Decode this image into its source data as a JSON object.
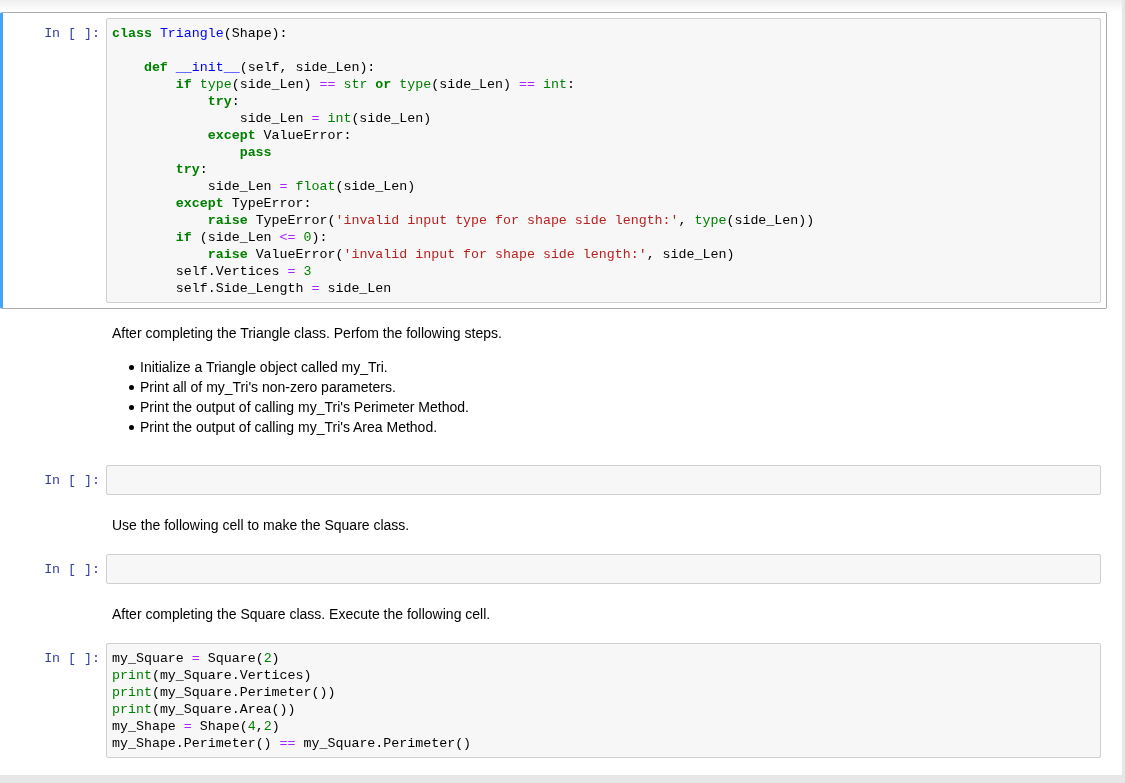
{
  "notebook": {
    "cells": [
      {
        "kind": "code",
        "selected": true,
        "prompt": "In [ ]:",
        "lines": [
          {
            "kind": "code",
            "tokens": [
              {
                "kind": "keyword",
                "text": "class"
              },
              {
                "kind": "name",
                "text": " Triangle"
              },
              {
                "kind": "plain",
                "text": "(Shape):"
              }
            ]
          },
          {
            "kind": "blank"
          },
          {
            "kind": "code",
            "tokens": [
              {
                "kind": "keyword",
                "text": "    def"
              },
              {
                "kind": "name",
                "text": " __init__"
              },
              {
                "kind": "plain",
                "text": "(self, side_Len):"
              }
            ]
          },
          {
            "kind": "code",
            "tokens": [
              {
                "kind": "keyword",
                "text": "        if"
              },
              {
                "kind": "builtin",
                "text": " type"
              },
              {
                "kind": "plain",
                "text": "(side_Len) "
              },
              {
                "kind": "operator",
                "text": "=="
              },
              {
                "kind": "builtin",
                "text": " str"
              },
              {
                "kind": "keyword",
                "text": " or"
              },
              {
                "kind": "builtin",
                "text": " type"
              },
              {
                "kind": "plain",
                "text": "(side_Len) "
              },
              {
                "kind": "operator",
                "text": "=="
              },
              {
                "kind": "builtin",
                "text": " int"
              },
              {
                "kind": "plain",
                "text": ":"
              }
            ]
          },
          {
            "kind": "code",
            "tokens": [
              {
                "kind": "keyword",
                "text": "            try"
              },
              {
                "kind": "plain",
                "text": ":"
              }
            ]
          },
          {
            "kind": "code",
            "tokens": [
              {
                "kind": "plain",
                "text": "                side_Len "
              },
              {
                "kind": "operator",
                "text": "="
              },
              {
                "kind": "builtin",
                "text": " int"
              },
              {
                "kind": "plain",
                "text": "(side_Len)"
              }
            ]
          },
          {
            "kind": "code",
            "tokens": [
              {
                "kind": "keyword",
                "text": "            except"
              },
              {
                "kind": "plain",
                "text": " ValueError:"
              }
            ]
          },
          {
            "kind": "code",
            "tokens": [
              {
                "kind": "keyword",
                "text": "                pass"
              }
            ]
          },
          {
            "kind": "code",
            "tokens": [
              {
                "kind": "keyword",
                "text": "        try"
              },
              {
                "kind": "plain",
                "text": ":"
              }
            ]
          },
          {
            "kind": "code",
            "tokens": [
              {
                "kind": "plain",
                "text": "            side_Len "
              },
              {
                "kind": "operator",
                "text": "="
              },
              {
                "kind": "builtin",
                "text": " float"
              },
              {
                "kind": "plain",
                "text": "(side_Len)"
              }
            ]
          },
          {
            "kind": "code",
            "tokens": [
              {
                "kind": "keyword",
                "text": "        except"
              },
              {
                "kind": "plain",
                "text": " TypeError:"
              }
            ]
          },
          {
            "kind": "code",
            "tokens": [
              {
                "kind": "keyword",
                "text": "            raise"
              },
              {
                "kind": "plain",
                "text": " TypeError("
              },
              {
                "kind": "string",
                "text": "'invalid input type for shape side length:'"
              },
              {
                "kind": "plain",
                "text": ", "
              },
              {
                "kind": "builtin",
                "text": "type"
              },
              {
                "kind": "plain",
                "text": "(side_Len))"
              }
            ]
          },
          {
            "kind": "code",
            "tokens": [
              {
                "kind": "keyword",
                "text": "        if"
              },
              {
                "kind": "plain",
                "text": " (side_Len "
              },
              {
                "kind": "operator",
                "text": "<="
              },
              {
                "kind": "number",
                "text": " 0"
              },
              {
                "kind": "plain",
                "text": "):"
              }
            ]
          },
          {
            "kind": "code",
            "tokens": [
              {
                "kind": "keyword",
                "text": "            raise"
              },
              {
                "kind": "plain",
                "text": " ValueError("
              },
              {
                "kind": "string",
                "text": "'invalid input for shape side length:'"
              },
              {
                "kind": "plain",
                "text": ", side_Len)"
              }
            ]
          },
          {
            "kind": "code",
            "tokens": [
              {
                "kind": "plain",
                "text": "        self.Vertices "
              },
              {
                "kind": "operator",
                "text": "="
              },
              {
                "kind": "number",
                "text": " 3"
              }
            ]
          },
          {
            "kind": "code",
            "tokens": [
              {
                "kind": "plain",
                "text": "        self.Side_Length "
              },
              {
                "kind": "operator",
                "text": "="
              },
              {
                "kind": "plain",
                "text": " side_Len"
              }
            ]
          }
        ]
      },
      {
        "kind": "markdown",
        "selected": false,
        "paragraph": "After completing the Triangle class. Perfom the following steps.",
        "bullets": [
          "Initialize a Triangle object called my_Tri.",
          "Print all of my_Tri's non-zero parameters.",
          "Print the output of calling my_Tri's Perimeter Method.",
          "Print the output of calling my_Tri's Area Method."
        ]
      },
      {
        "kind": "code",
        "selected": false,
        "prompt": "In [ ]:"
      },
      {
        "kind": "markdown",
        "selected": false,
        "paragraph": "Use the following cell to make the Square class."
      },
      {
        "kind": "code",
        "selected": false,
        "prompt": "In [ ]:"
      },
      {
        "kind": "markdown",
        "selected": false,
        "paragraph": "After completing the Square class. Execute the following cell."
      },
      {
        "kind": "code",
        "selected": false,
        "prompt": "In [ ]:",
        "lines": [
          {
            "kind": "code",
            "tokens": [
              {
                "kind": "plain",
                "text": "my_Square "
              },
              {
                "kind": "operator",
                "text": "="
              },
              {
                "kind": "plain",
                "text": " Square("
              },
              {
                "kind": "number",
                "text": "2"
              },
              {
                "kind": "plain",
                "text": ")"
              }
            ]
          },
          {
            "kind": "code",
            "tokens": [
              {
                "kind": "builtin",
                "text": "print"
              },
              {
                "kind": "plain",
                "text": "(my_Square.Vertices)"
              }
            ]
          },
          {
            "kind": "code",
            "tokens": [
              {
                "kind": "builtin",
                "text": "print"
              },
              {
                "kind": "plain",
                "text": "(my_Square.Perimeter())"
              }
            ]
          },
          {
            "kind": "code",
            "tokens": [
              {
                "kind": "builtin",
                "text": "print"
              },
              {
                "kind": "plain",
                "text": "(my_Square.Area())"
              }
            ]
          },
          {
            "kind": "code",
            "tokens": [
              {
                "kind": "plain",
                "text": "my_Shape "
              },
              {
                "kind": "operator",
                "text": "="
              },
              {
                "kind": "plain",
                "text": " Shape("
              },
              {
                "kind": "number",
                "text": "4"
              },
              {
                "kind": "plain",
                "text": ","
              },
              {
                "kind": "number",
                "text": "2"
              },
              {
                "kind": "plain",
                "text": ")"
              }
            ]
          },
          {
            "kind": "code",
            "tokens": [
              {
                "kind": "plain",
                "text": "my_Shape.Perimeter() "
              },
              {
                "kind": "operator",
                "text": "=="
              },
              {
                "kind": "plain",
                "text": " my_Square.Perimeter()"
              }
            ]
          }
        ]
      }
    ]
  }
}
